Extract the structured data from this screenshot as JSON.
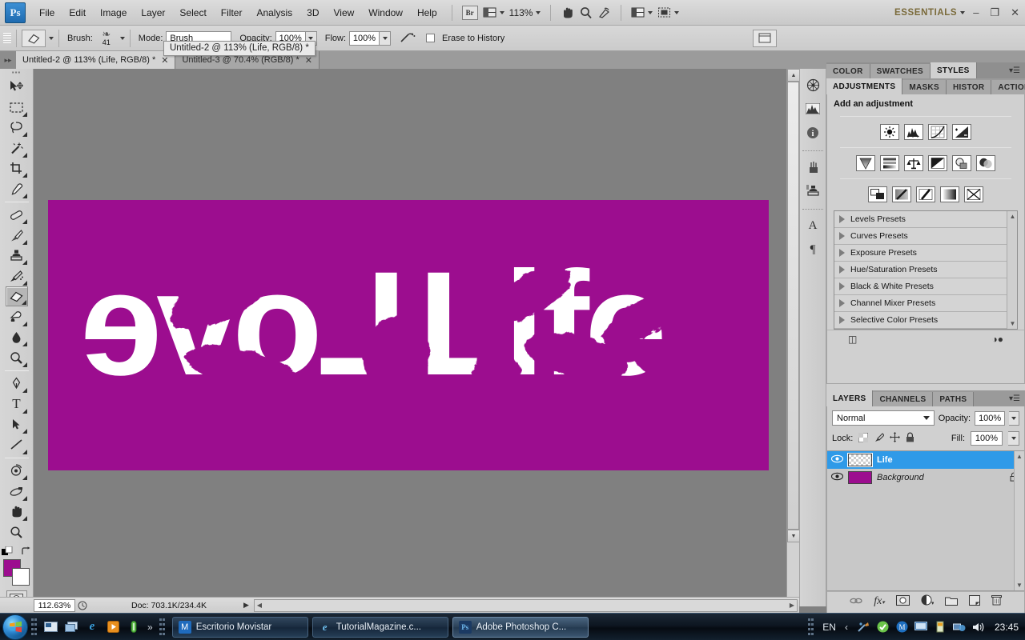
{
  "app": {
    "logo": "Ps",
    "workspace": "ESSENTIALS",
    "zoom_level": "113%"
  },
  "menubar": {
    "items": [
      "File",
      "Edit",
      "Image",
      "Layer",
      "Select",
      "Filter",
      "Analysis",
      "3D",
      "View",
      "Window",
      "Help"
    ],
    "bridge_label": "Br",
    "icons": [
      "hand-tool-icon",
      "zoom-tool-icon",
      "rotate-view-icon",
      "screen-mode-icon",
      "arrange-documents-icon"
    ],
    "window_controls": {
      "minimize": "–",
      "restore": "❐",
      "close": "✕"
    }
  },
  "options_bar": {
    "tool_preset_icon": "eraser-icon",
    "brush_label": "Brush:",
    "brush_size": "41",
    "mode_label": "Mode:",
    "mode_value": "Brush",
    "opacity_label": "Opacity:",
    "opacity_value": "100%",
    "flow_label": "Flow:",
    "flow_value": "100%",
    "airbrush_icon": "airbrush-icon",
    "erase_to_history_label": "Erase to History"
  },
  "tooltip": {
    "text": "Untitled-2 @ 113% (Life, RGB/8) *"
  },
  "tabs": [
    {
      "label": "Untitled-2 @ 113% (Life, RGB/8) *",
      "close": "✕",
      "active": true
    },
    {
      "label": "Untitled-3 @ 70.4% (RGB/8) *",
      "close": "✕",
      "active": false
    }
  ],
  "toolbar": {
    "tools": [
      {
        "name": "move-tool",
        "glyph": "↖",
        "has_submenu": false
      },
      {
        "name": "rectangular-marquee-tool",
        "glyph": "⬚",
        "has_submenu": true
      },
      {
        "name": "lasso-tool",
        "glyph": "○",
        "has_submenu": true
      },
      {
        "name": "magic-wand-tool",
        "glyph": "✦",
        "has_submenu": true
      },
      {
        "name": "crop-tool",
        "glyph": "⌗",
        "has_submenu": true
      },
      {
        "name": "eyedropper-tool",
        "glyph": "✐",
        "has_submenu": true
      },
      {
        "name": "spot-healing-brush-tool",
        "glyph": "☷",
        "has_submenu": true
      },
      {
        "name": "brush-tool",
        "glyph": "✒",
        "has_submenu": true
      },
      {
        "name": "clone-stamp-tool",
        "glyph": "⚓",
        "has_submenu": true
      },
      {
        "name": "history-brush-tool",
        "glyph": "✎",
        "has_submenu": true
      },
      {
        "name": "eraser-tool",
        "glyph": "▱",
        "has_submenu": true,
        "selected": true
      },
      {
        "name": "gradient-tool",
        "glyph": "◢",
        "has_submenu": true
      },
      {
        "name": "blur-tool",
        "glyph": "●",
        "has_submenu": true
      },
      {
        "name": "dodge-tool",
        "glyph": "◔",
        "has_submenu": true
      },
      {
        "name": "pen-tool",
        "glyph": "✒",
        "has_submenu": true
      },
      {
        "name": "horizontal-type-tool",
        "glyph": "T",
        "has_submenu": true
      },
      {
        "name": "path-selection-tool",
        "glyph": "➤",
        "has_submenu": true
      },
      {
        "name": "line-shape-tool",
        "glyph": "╱",
        "has_submenu": true
      },
      {
        "name": "3d-rotate-tool",
        "glyph": "↻",
        "has_submenu": true
      },
      {
        "name": "3d-orbit-tool",
        "glyph": "◯",
        "has_submenu": true
      },
      {
        "name": "hand-tool",
        "glyph": "✋",
        "has_submenu": true
      },
      {
        "name": "zoom-tool",
        "glyph": "⚲",
        "has_submenu": false
      }
    ],
    "foreground_color": "#9c0d8f",
    "background_color": "#ffffff",
    "quick_mask_icon": "quick-mask-icon",
    "default_colors_icon": "default-colors-icon",
    "swap_colors_icon": "swap-colors-icon"
  },
  "canvas": {
    "background_color": "#9c0d8f",
    "artwork_color": "#ffffff",
    "text_left": "evoL",
    "text_right": "Life",
    "description": "Mirrored Love and Life grunge brush lettering"
  },
  "status_bar": {
    "zoom": "112.63%",
    "doc_label": "Doc: 703.1K/234.4K"
  },
  "mini_dock": {
    "icons": [
      {
        "name": "navigator-icon",
        "glyph": "⎈"
      },
      {
        "name": "histogram-icon",
        "glyph": "ᵛ"
      },
      {
        "name": "info-icon",
        "glyph": "ⓘ"
      },
      {
        "name": "brush-panel-icon",
        "glyph": "✐"
      },
      {
        "name": "clone-source-icon",
        "glyph": "⎙"
      },
      {
        "name": "character-panel-icon",
        "glyph": "A"
      },
      {
        "name": "paragraph-panel-icon",
        "glyph": "¶"
      }
    ]
  },
  "top_panel": {
    "tabs": [
      {
        "label": "COLOR",
        "active": false
      },
      {
        "label": "SWATCHES",
        "active": false
      },
      {
        "label": "STYLES",
        "active": true
      }
    ],
    "menu_icon": "panel-menu-icon"
  },
  "adjustments_panel": {
    "tabs": [
      {
        "label": "ADJUSTMENTS",
        "active": true
      },
      {
        "label": "MASKS",
        "active": false
      },
      {
        "label": "HISTOR",
        "active": false
      },
      {
        "label": "ACTION",
        "active": false
      }
    ],
    "title": "Add an adjustment",
    "icon_rows": [
      [
        {
          "name": "brightness-contrast-icon",
          "glyph": "☀"
        },
        {
          "name": "levels-icon",
          "glyph": "ᵛ"
        },
        {
          "name": "curves-icon",
          "glyph": "∿"
        },
        {
          "name": "exposure-icon",
          "glyph": "◢"
        }
      ],
      [
        {
          "name": "vibrance-icon",
          "glyph": "▽"
        },
        {
          "name": "hue-saturation-icon",
          "glyph": "☰"
        },
        {
          "name": "color-balance-icon",
          "glyph": "⚖"
        },
        {
          "name": "black-white-icon",
          "glyph": "◤"
        },
        {
          "name": "photo-filter-icon",
          "glyph": "◎"
        },
        {
          "name": "channel-mixer-icon",
          "glyph": "◑"
        }
      ],
      [
        {
          "name": "invert-icon",
          "glyph": "◱"
        },
        {
          "name": "posterize-icon",
          "glyph": "╱"
        },
        {
          "name": "threshold-icon",
          "glyph": "∕"
        },
        {
          "name": "gradient-map-icon",
          "glyph": "▧"
        },
        {
          "name": "selective-color-icon",
          "glyph": "✕"
        }
      ]
    ],
    "presets": [
      "Levels Presets",
      "Curves Presets",
      "Exposure Presets",
      "Hue/Saturation Presets",
      "Black & White Presets",
      "Channel Mixer Presets",
      "Selective Color Presets"
    ],
    "footer_icons": [
      {
        "name": "expand-view-icon",
        "glyph": "❐"
      },
      {
        "name": "clip-to-layer-icon",
        "glyph": "◑"
      }
    ]
  },
  "layers_panel": {
    "tabs": [
      {
        "label": "LAYERS",
        "active": true
      },
      {
        "label": "CHANNELS",
        "active": false
      },
      {
        "label": "PATHS",
        "active": false
      }
    ],
    "blend_mode": "Normal",
    "opacity_label": "Opacity:",
    "opacity_value": "100%",
    "lock_label": "Lock:",
    "lock_icons": [
      {
        "name": "lock-transparency-icon",
        "glyph": "⬚"
      },
      {
        "name": "lock-image-pixels-icon",
        "glyph": "✐"
      },
      {
        "name": "lock-position-icon",
        "glyph": "✥"
      },
      {
        "name": "lock-all-icon",
        "glyph": "ὑ2"
      }
    ],
    "fill_label": "Fill:",
    "fill_value": "100%",
    "layers": [
      {
        "name": "Life",
        "selected": true,
        "visible": true,
        "thumb": "transparent",
        "locked": false
      },
      {
        "name": "Background",
        "selected": false,
        "visible": true,
        "thumb": "#9c0d8f",
        "locked": true
      }
    ],
    "footer_icons": [
      {
        "name": "link-layers-icon",
        "glyph": "⚭"
      },
      {
        "name": "layer-style-icon",
        "glyph": "ƒˣ"
      },
      {
        "name": "layer-mask-icon",
        "glyph": "■"
      },
      {
        "name": "adjustment-layer-icon",
        "glyph": "◑"
      },
      {
        "name": "new-group-icon",
        "glyph": "▭"
      },
      {
        "name": "new-layer-icon",
        "glyph": "❐"
      },
      {
        "name": "delete-layer-icon",
        "glyph": "Ὕ1"
      }
    ]
  },
  "taskbar": {
    "start_icon": "windows-start-icon",
    "quick_launch": [
      {
        "name": "show-desktop-icon",
        "glyph": "▣"
      },
      {
        "name": "switch-windows-icon",
        "glyph": "❐"
      },
      {
        "name": "internet-explorer-icon",
        "glyph": "e"
      },
      {
        "name": "media-player-icon",
        "glyph": "▶"
      },
      {
        "name": "app-icon",
        "glyph": "❘"
      }
    ],
    "overflow": "»",
    "buttons": [
      {
        "label": "Escritorio Movistar",
        "icon": "movistar-icon",
        "active": false
      },
      {
        "label": "TutorialMagazine.c...",
        "icon": "internet-explorer-icon",
        "active": false
      },
      {
        "label": "Adobe Photoshop C...",
        "icon": "photoshop-icon",
        "active": true
      }
    ],
    "tray": {
      "language": "EN",
      "expand_icon": "‹",
      "icons": [
        {
          "name": "network-activity-icon",
          "glyph": "⚒"
        },
        {
          "name": "antivirus-icon",
          "glyph": "✔"
        },
        {
          "name": "movistar-tray-icon",
          "glyph": "Ⓜ"
        },
        {
          "name": "display-icon",
          "glyph": "▣"
        },
        {
          "name": "battery-icon",
          "glyph": "❙"
        },
        {
          "name": "network-icon",
          "glyph": "◰"
        },
        {
          "name": "volume-icon",
          "glyph": "🔊"
        }
      ],
      "clock": "23:45"
    }
  }
}
